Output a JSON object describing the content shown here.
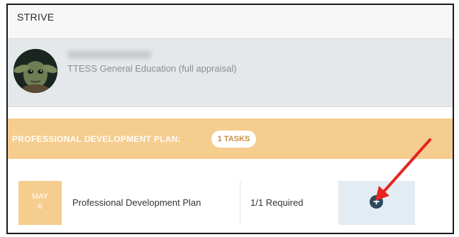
{
  "header": {
    "title": "STRIVE"
  },
  "profile": {
    "subtitle": "TTESS General Education (full appraisal)"
  },
  "plan": {
    "title": "PROFESSIONAL DEVELOPMENT PLAN:",
    "task_count": "1 TASKS"
  },
  "task_row": {
    "month": "MAY",
    "day": "6",
    "name": "Professional Development Plan",
    "required": "1/1 Required",
    "add_icon": "plus-circle-icon"
  },
  "colors": {
    "band": "#f5cd8f",
    "add_cell": "#e3ecf2",
    "add_button": "#2b4a5e",
    "annotation_arrow": "#e52421"
  }
}
